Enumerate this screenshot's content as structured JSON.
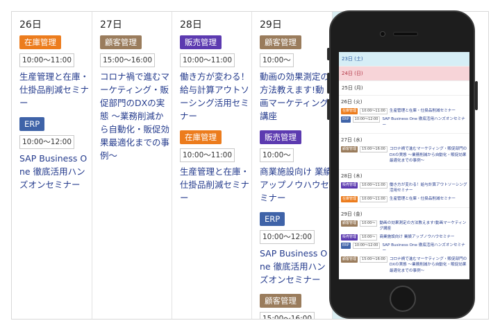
{
  "colors": {
    "stock": "#ec7c1d",
    "customer": "#9a7c5c",
    "sales": "#5c3ab0",
    "erp": "#3f63a8",
    "link": "#233a8c"
  },
  "columns": [
    {
      "day": "26日",
      "events": [
        {
          "tag": "在庫管理",
          "color": "#ec7c1d",
          "time": "10:00〜11:00",
          "title": "生産管理と在庫・仕掛品削減セミナー"
        },
        {
          "tag": "ERP",
          "color": "#3f63a8",
          "time": "10:00〜12:00",
          "title": "SAP Business One 徹底活用ハンズオンセミナー"
        }
      ]
    },
    {
      "day": "27日",
      "events": [
        {
          "tag": "顧客管理",
          "color": "#9a7c5c",
          "time": "15:00〜16:00",
          "title": "コロナ禍で進むマーケティング・販促部門のDXの実態 〜業務削減から自動化・販促効果最適化までの事例〜"
        }
      ]
    },
    {
      "day": "28日",
      "events": [
        {
          "tag": "販売管理",
          "color": "#5c3ab0",
          "time": "10:00〜11:00",
          "title": "働き方が変わる！給与計算アウトソーシング活用セミナー"
        },
        {
          "tag": "在庫管理",
          "color": "#ec7c1d",
          "time": "10:00〜11:00",
          "title": "生産管理と在庫・仕掛品削減セミナー"
        }
      ]
    },
    {
      "day": "29日",
      "events": [
        {
          "tag": "顧客管理",
          "color": "#9a7c5c",
          "time": "10:00〜",
          "title": "動画の効果測定の方法教えます!動画マーケティング講座"
        },
        {
          "tag": "販売管理",
          "color": "#5c3ab0",
          "time": "10:00〜",
          "title": "商業施設向け 業績アップノウハウセミナー"
        },
        {
          "tag": "ERP",
          "color": "#3f63a8",
          "time": "10:00〜12:00",
          "title": "SAP Business One 徹底活用ハンズオンセミナー"
        },
        {
          "tag": "顧客管理",
          "color": "#9a7c5c",
          "time": "15:00〜16:00",
          "title": ""
        }
      ]
    }
  ],
  "phone": {
    "days_top": [
      {
        "label": "23日 (土)",
        "style": "sat"
      },
      {
        "label": "24日 (日)",
        "style": "sun"
      },
      {
        "label": "25日 (月)",
        "style": "plain"
      }
    ],
    "sections": [
      {
        "head": "26日 (火)",
        "rows": [
          {
            "tag": "在庫管理",
            "color": "#ec7c1d",
            "time": "10:00〜11:00",
            "title": "生産管理と在庫・仕掛品削減セミナー"
          },
          {
            "tag": "ERP",
            "color": "#3f63a8",
            "time": "10:00〜12:00",
            "title": "SAP Business One 徹底活用ハンズオンセミナー"
          }
        ]
      },
      {
        "head": "27日 (水)",
        "rows": [
          {
            "tag": "顧客管理",
            "color": "#9a7c5c",
            "time": "15:00〜16:00",
            "title": "コロナ禍で進むマーケティング・販促部門のDXの実態 〜業務削減から自動化・販促効果最適化までの事例〜"
          }
        ]
      },
      {
        "head": "28日 (木)",
        "rows": [
          {
            "tag": "販売管理",
            "color": "#5c3ab0",
            "time": "10:00〜11:00",
            "title": "働き方が変わる！給与計算アウトソーシング活用セミナー"
          },
          {
            "tag": "在庫管理",
            "color": "#ec7c1d",
            "time": "10:00〜11:00",
            "title": "生産管理と在庫・仕掛品削減セミナー"
          }
        ]
      },
      {
        "head": "29日 (金)",
        "rows": [
          {
            "tag": "顧客管理",
            "color": "#9a7c5c",
            "time": "10:00〜",
            "title": "動画の効果測定の方法教えます!動画マーケティング講座"
          },
          {
            "tag": "販売管理",
            "color": "#5c3ab0",
            "time": "10:00〜",
            "title": "商業施設向け 業績アップノウハウセミナー"
          },
          {
            "tag": "ERP",
            "color": "#3f63a8",
            "time": "10:00〜12:00",
            "title": "SAP Business One 徹底活用ハンズオンセミナー"
          },
          {
            "tag": "顧客管理",
            "color": "#9a7c5c",
            "time": "15:00〜16:00",
            "title": "コロナ禍で進むマーケティング・販促部門のDXの実態 〜業務削減から自動化・販促効果最適化までの事例〜"
          }
        ]
      }
    ]
  }
}
